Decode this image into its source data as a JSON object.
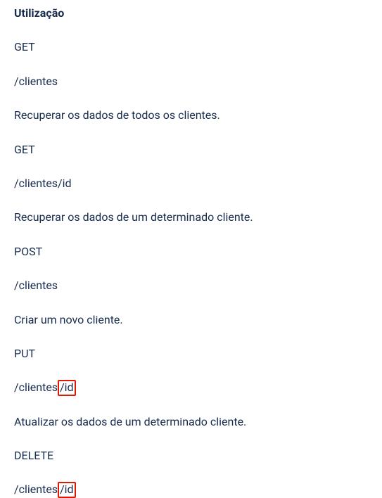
{
  "heading": "Utilização",
  "items": [
    {
      "line": "GET"
    },
    {
      "line": "/clientes"
    },
    {
      "line": "Recuperar os dados de todos os clientes."
    },
    {
      "line": "GET"
    },
    {
      "line": "/clientes/id"
    },
    {
      "line": "Recuperar os dados de um determinado cliente."
    },
    {
      "line": "POST"
    },
    {
      "line": "/clientes"
    },
    {
      "line": "Criar um novo cliente."
    },
    {
      "line": "PUT"
    },
    {
      "prefix": "/clientes",
      "highlight": "/id"
    },
    {
      "line": "Atualizar os dados de um determinado cliente."
    },
    {
      "line": "DELETE"
    },
    {
      "prefix": "/clientes",
      "highlight": "/id"
    }
  ]
}
